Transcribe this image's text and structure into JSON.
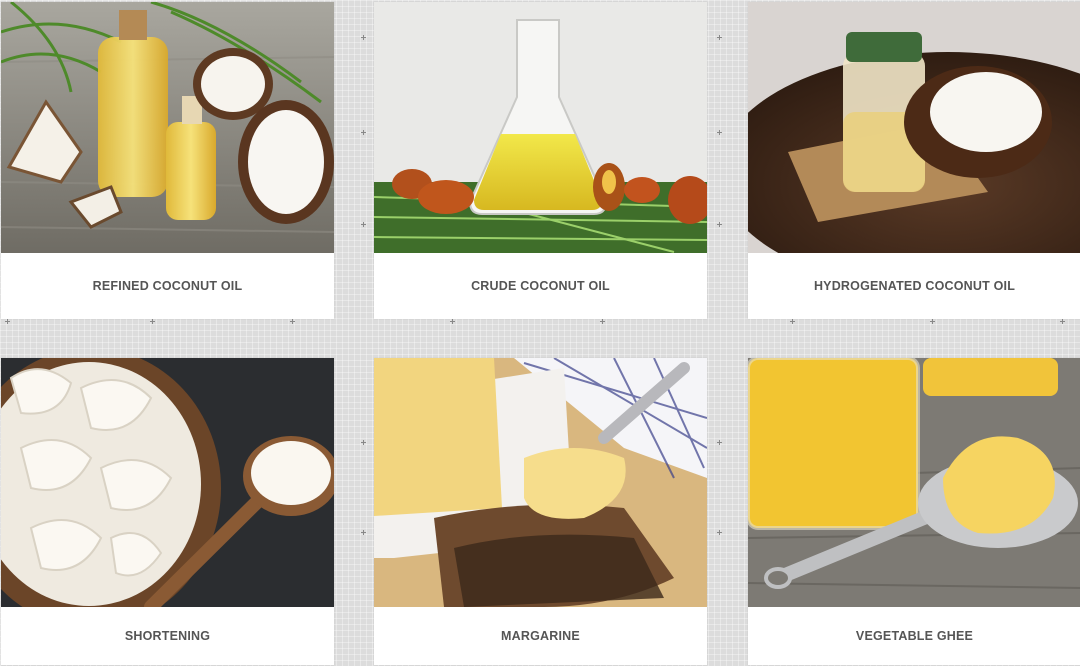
{
  "products": [
    {
      "name": "REFINED COCONUT OIL",
      "image": "refined-coconut-oil-photo"
    },
    {
      "name": "CRUDE COCONUT OIL",
      "image": "crude-coconut-oil-photo"
    },
    {
      "name": "HYDROGENATED COCONUT OIL",
      "image": "hydrogenated-coconut-oil-photo"
    },
    {
      "name": "SHORTENING",
      "image": "shortening-photo"
    },
    {
      "name": "MARGARINE",
      "image": "margarine-photo"
    },
    {
      "name": "VEGETABLE GHEE",
      "image": "vegetable-ghee-photo"
    }
  ]
}
